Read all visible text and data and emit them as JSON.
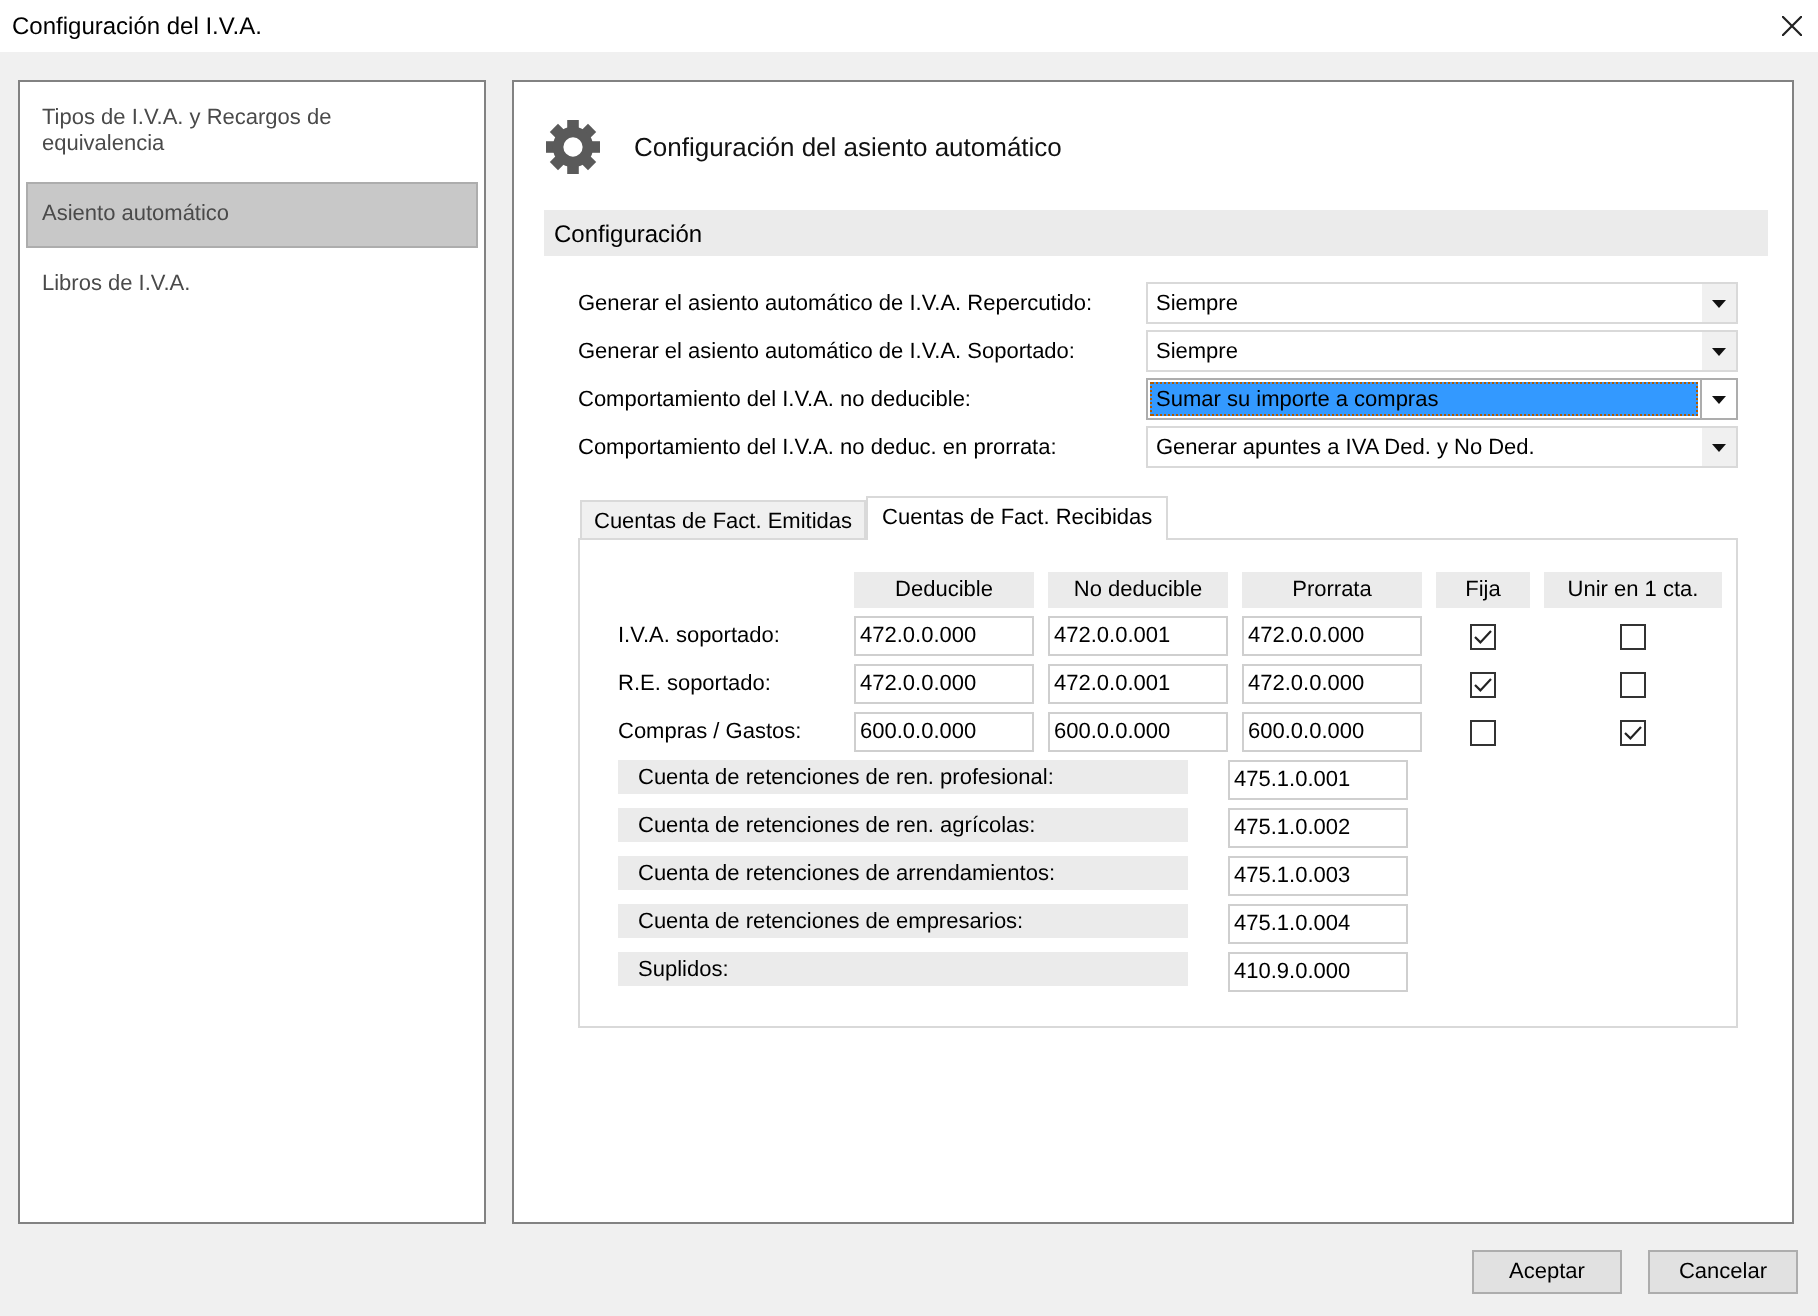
{
  "window": {
    "title": "Configuración del I.V.A."
  },
  "sidebar": {
    "items": [
      {
        "label": "Tipos de I.V.A. y Recargos de equivalencia",
        "selected": false
      },
      {
        "label": "Asiento automático",
        "selected": true
      },
      {
        "label": "Libros de I.V.A.",
        "selected": false
      }
    ]
  },
  "header": {
    "title": "Configuración del asiento automático"
  },
  "section": {
    "title": "Configuración"
  },
  "settings": [
    {
      "label": "Generar el asiento automático de I.V.A. Repercutido:",
      "value": "Siempre",
      "focused": false
    },
    {
      "label": "Generar el asiento automático de I.V.A. Soportado:",
      "value": "Siempre",
      "focused": false
    },
    {
      "label": "Comportamiento del I.V.A. no deducible:",
      "value": "Sumar su importe a compras",
      "focused": true
    },
    {
      "label": "Comportamiento del I.V.A. no deduc. en prorrata:",
      "value": "Generar apuntes a IVA Ded. y No Ded.",
      "focused": false
    }
  ],
  "tabs": [
    {
      "label": "Cuentas de Fact. Emitidas",
      "selected": false
    },
    {
      "label": "Cuentas de Fact. Recibidas",
      "selected": true
    }
  ],
  "accounts": {
    "columns": [
      "Deducible",
      "No deducible",
      "Prorrata",
      "Fija",
      "Unir en 1 cta."
    ],
    "rows": [
      {
        "label": "I.V.A. soportado:",
        "values": [
          "472.0.0.000",
          "472.0.0.001",
          "472.0.0.000"
        ],
        "fija": true,
        "unir_en_1_cta": false
      },
      {
        "label": "R.E. soportado:",
        "values": [
          "472.0.0.000",
          "472.0.0.001",
          "472.0.0.000"
        ],
        "fija": true,
        "unir_en_1_cta": false
      },
      {
        "label": "Compras / Gastos:",
        "values": [
          "600.0.0.000",
          "600.0.0.000",
          "600.0.0.000"
        ],
        "fija": false,
        "unir_en_1_cta": true
      }
    ]
  },
  "retentions": [
    {
      "label": "Cuenta de retenciones de ren. profesional:",
      "value": "475.1.0.001"
    },
    {
      "label": "Cuenta de retenciones de ren. agrícolas:",
      "value": "475.1.0.002"
    },
    {
      "label": "Cuenta de retenciones de arrendamientos:",
      "value": "475.1.0.003"
    },
    {
      "label": "Cuenta de retenciones de empresarios:",
      "value": "475.1.0.004"
    },
    {
      "label": "Suplidos:",
      "value": "410.9.0.000"
    }
  ],
  "buttons": [
    {
      "label": "Aceptar"
    },
    {
      "label": "Cancelar"
    }
  ]
}
